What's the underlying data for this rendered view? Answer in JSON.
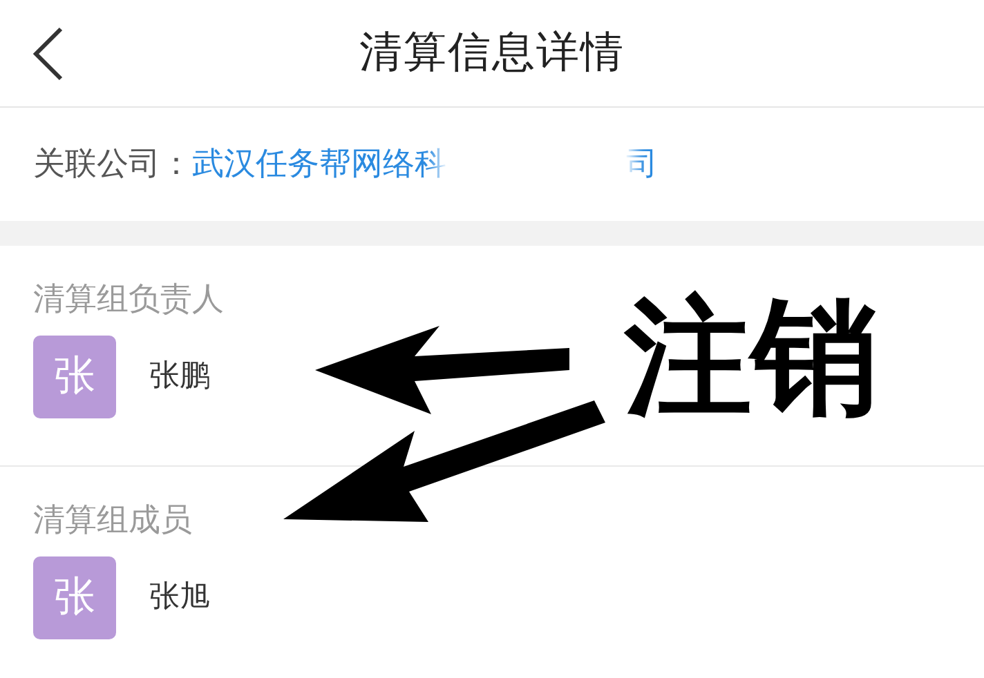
{
  "header": {
    "title": "清算信息详情"
  },
  "company": {
    "label": "关联公司：",
    "name_start": "武汉任务帮网络科",
    "name_end": "司"
  },
  "sections": [
    {
      "label": "清算组负责人",
      "members": [
        {
          "avatar": "张",
          "name": "张鹏"
        }
      ]
    },
    {
      "label": "清算组成员",
      "members": [
        {
          "avatar": "张",
          "name": "张旭"
        }
      ]
    }
  ],
  "annotation": {
    "text": "注销"
  }
}
